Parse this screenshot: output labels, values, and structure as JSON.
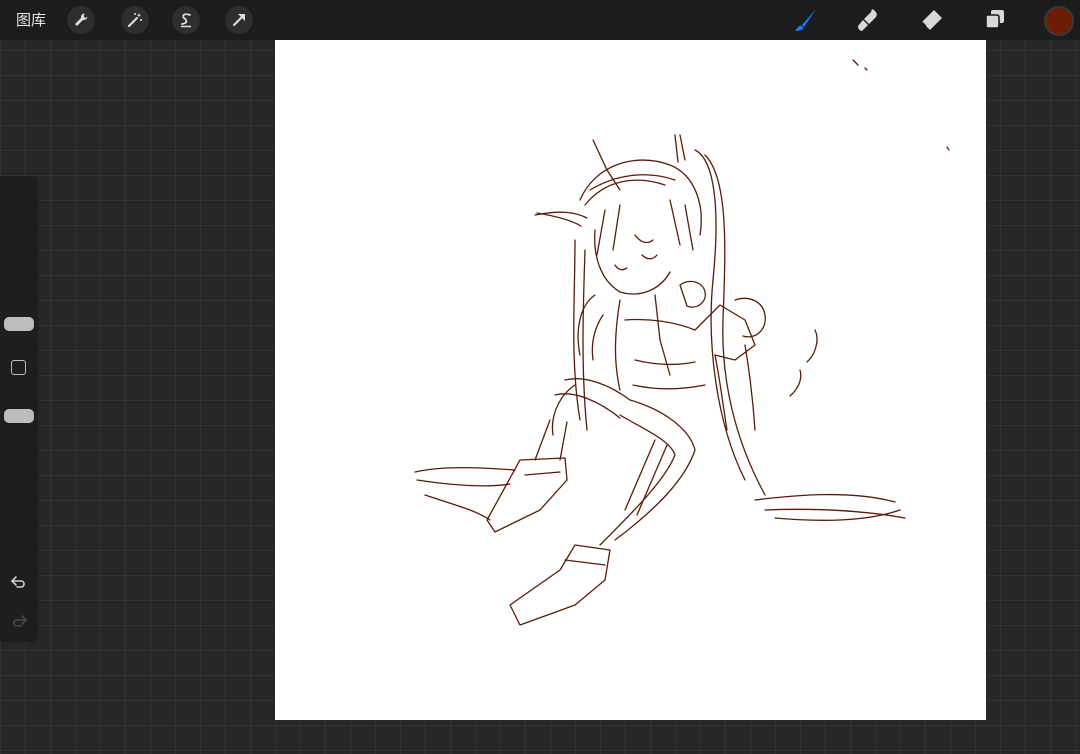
{
  "app": {
    "gallery_label": "图库"
  },
  "toolbar_left": {
    "icons": [
      "wrench-icon",
      "magic-wand-icon",
      "selection-s-icon",
      "transform-arrow-icon"
    ]
  },
  "toolbar_right": {
    "icons": [
      "brush-icon",
      "smudge-icon",
      "eraser-icon",
      "layers-icon"
    ],
    "active_tool": "brush",
    "active_color": "#6b1d05",
    "active_tool_color": "#1e7bff"
  },
  "sidebar": {
    "brush_size_level": 0.35,
    "opacity_level": 0.75,
    "icons": [
      "modify-square-icon",
      "undo-icon",
      "redo-icon"
    ]
  },
  "canvas": {
    "background": "#ffffff",
    "sketch_color": "#5a1c0a"
  }
}
